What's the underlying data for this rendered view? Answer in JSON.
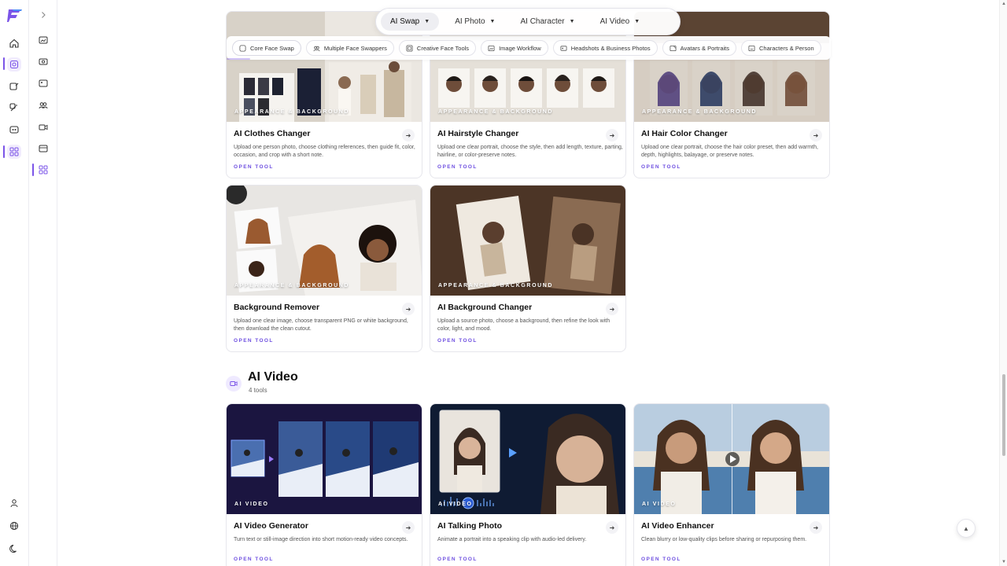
{
  "topnav": {
    "items": [
      {
        "label": "AI Swap",
        "active": true
      },
      {
        "label": "AI Photo",
        "active": false
      },
      {
        "label": "AI Character",
        "active": false
      },
      {
        "label": "AI Video",
        "active": false
      }
    ]
  },
  "catbar": {
    "items": [
      {
        "label": "Core Face Swap",
        "icon": "face-icon"
      },
      {
        "label": "Multiple Face Swappers",
        "icon": "users-icon"
      },
      {
        "label": "Creative Face Tools",
        "icon": "palette-icon"
      },
      {
        "label": "Image Workflow",
        "icon": "image-icon"
      },
      {
        "label": "Headshots & Business Photos",
        "icon": "id-card-icon"
      },
      {
        "label": "Avatars & Portraits",
        "icon": "portrait-icon"
      },
      {
        "label": "Characters & Person",
        "icon": "character-icon"
      }
    ]
  },
  "cards": [
    {
      "title": "AI Clothes Changer",
      "category": "Appearance & Background",
      "desc": "Upload one person photo, choose clothing references, then guide fit, color, occasion, and crop with a short note.",
      "cta": "OPEN TOOL"
    },
    {
      "title": "AI Hairstyle Changer",
      "category": "Appearance & Background",
      "desc": "Upload one clear portrait, choose the style, then add length, texture, parting, hairline, or color-preserve notes.",
      "cta": "OPEN TOOL"
    },
    {
      "title": "AI Hair Color Changer",
      "category": "Appearance & Background",
      "desc": "Upload one clear portrait, choose the hair color preset, then add warmth, depth, highlights, balayage, or preserve notes.",
      "cta": "OPEN TOOL"
    },
    {
      "title": "Background Remover",
      "category": "Appearance & Background",
      "desc": "Upload one clear image, choose transparent PNG or white background, then download the clean cutout.",
      "cta": "OPEN TOOL"
    },
    {
      "title": "AI Background Changer",
      "category": "Appearance & Background",
      "desc": "Upload a source photo, choose a background, then refine the look with color, light, and mood.",
      "cta": "OPEN TOOL"
    }
  ],
  "video_section": {
    "title": "AI Video",
    "count": "4 tools",
    "cards": [
      {
        "title": "AI Video Generator",
        "category": "AI Video",
        "desc": "Turn text or still-image direction into short motion-ready video concepts.",
        "cta": "OPEN TOOL"
      },
      {
        "title": "AI Talking Photo",
        "category": "AI Video",
        "desc": "Animate a portrait into a speaking clip with audio-led delivery.",
        "cta": "OPEN TOOL"
      },
      {
        "title": "AI Video Enhancer",
        "category": "AI Video",
        "desc": "Clean blurry or low-quality clips before sharing or repurposing them.",
        "cta": "OPEN TOOL"
      }
    ]
  },
  "colors": {
    "accent": "#7b54e8",
    "cta": "#6d4ee0"
  }
}
